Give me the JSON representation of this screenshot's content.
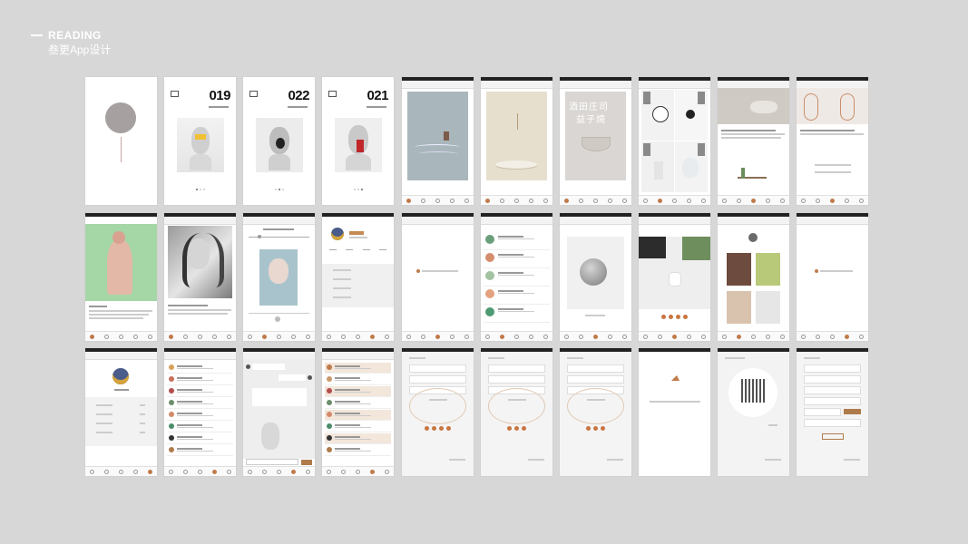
{
  "header": {
    "title": "READING",
    "subtitle": "叁更App设计"
  },
  "covers": {
    "c2": {
      "number": "019"
    },
    "c3": {
      "number": "022"
    },
    "c4": {
      "number": "021"
    }
  },
  "posters": {
    "c7": {
      "line1": "酒田庄司",
      "line2": "益子燒"
    }
  },
  "colors": {
    "background": "#d7d7d7",
    "accent": "#c07a4a",
    "status_bar": "#222222"
  },
  "icons": [
    "home-icon",
    "reader-icon",
    "discover-icon",
    "profile-icon",
    "settings-icon"
  ]
}
